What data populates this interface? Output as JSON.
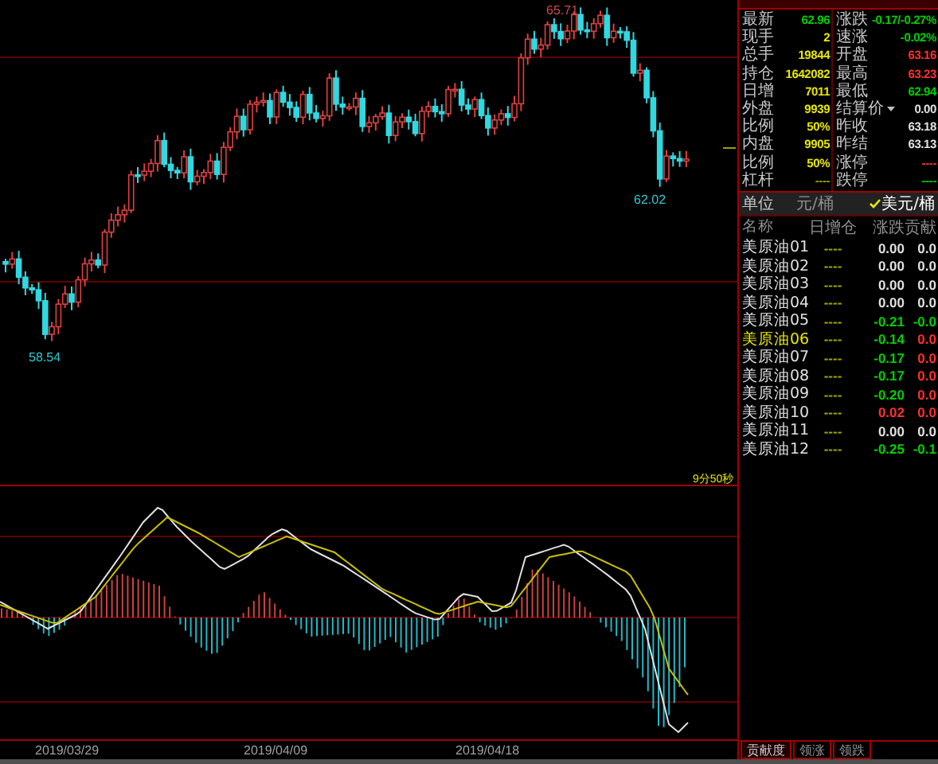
{
  "chart": {
    "high_label": "65.71",
    "low_label": "62.02",
    "start_low_label": "58.54",
    "timer": "9分50秒",
    "dates": [
      "2019/03/29",
      "2019/04/09",
      "2019/04/18"
    ]
  },
  "quote": {
    "left": [
      {
        "label": "最新",
        "value": "62.96",
        "color": "#00d000"
      },
      {
        "label": "现手",
        "value": "2",
        "color": "#e8e800"
      },
      {
        "label": "总手",
        "value": "19844",
        "color": "#e8e800"
      },
      {
        "label": "持仓",
        "value": "1642082",
        "color": "#e8e800"
      },
      {
        "label": "日增",
        "value": "7011",
        "color": "#e8e800"
      },
      {
        "label": "外盘",
        "value": "9939",
        "color": "#e8e800"
      },
      {
        "label": "比例",
        "value": "50%",
        "color": "#e8e800"
      },
      {
        "label": "内盘",
        "value": "9905",
        "color": "#e8e800"
      },
      {
        "label": "比例",
        "value": "50%",
        "color": "#e8e800"
      },
      {
        "label": "杠杆",
        "value": "----",
        "color": "#a0a000"
      }
    ],
    "right": [
      {
        "label": "涨跌",
        "value": "-0.17/-0.27%",
        "color": "#00d000",
        "has_menu": false
      },
      {
        "label": "速涨",
        "value": "-0.02%",
        "color": "#00d000",
        "has_menu": false
      },
      {
        "label": "开盘",
        "value": "63.16",
        "color": "#ff3030",
        "has_menu": false
      },
      {
        "label": "最高",
        "value": "63.23",
        "color": "#ff3030",
        "has_menu": false
      },
      {
        "label": "最低",
        "value": "62.94",
        "color": "#00d000",
        "has_menu": false
      },
      {
        "label": "结算价",
        "value": "0.00",
        "color": "#e0e0e0",
        "has_menu": true
      },
      {
        "label": "昨收",
        "value": "63.18",
        "color": "#e0e0e0",
        "has_menu": false
      },
      {
        "label": "昨结",
        "value": "63.13",
        "color": "#e0e0e0",
        "has_menu": false
      },
      {
        "label": "涨停",
        "value": "----",
        "color": "#ff3030",
        "has_menu": false
      },
      {
        "label": "跌停",
        "value": "----",
        "color": "#00d000",
        "has_menu": false
      }
    ]
  },
  "unit": {
    "label": "单位",
    "options": [
      {
        "label": "元/桶",
        "selected": false
      },
      {
        "label": "美元/桶",
        "selected": true
      }
    ]
  },
  "table": {
    "columns": [
      "名称",
      "日增仓",
      "涨跌",
      "贡献"
    ],
    "rows": [
      {
        "name": "美原油01",
        "selected": false,
        "position": "----",
        "change": {
          "text": "0.00",
          "color": "#e0e0e0"
        },
        "contrib": {
          "text": "0.0",
          "color": "#e0e0e0"
        }
      },
      {
        "name": "美原油02",
        "selected": false,
        "position": "----",
        "change": {
          "text": "0.00",
          "color": "#e0e0e0"
        },
        "contrib": {
          "text": "0.0",
          "color": "#e0e0e0"
        }
      },
      {
        "name": "美原油03",
        "selected": false,
        "position": "----",
        "change": {
          "text": "0.00",
          "color": "#e0e0e0"
        },
        "contrib": {
          "text": "0.0",
          "color": "#e0e0e0"
        }
      },
      {
        "name": "美原油04",
        "selected": false,
        "position": "----",
        "change": {
          "text": "0.00",
          "color": "#e0e0e0"
        },
        "contrib": {
          "text": "0.0",
          "color": "#e0e0e0"
        }
      },
      {
        "name": "美原油05",
        "selected": false,
        "position": "----",
        "change": {
          "text": "-0.21",
          "color": "#00d000"
        },
        "contrib": {
          "text": "-0.0",
          "color": "#00d000"
        }
      },
      {
        "name": "美原油06",
        "selected": true,
        "position": "----",
        "change": {
          "text": "-0.14",
          "color": "#00d000"
        },
        "contrib": {
          "text": "0.0",
          "color": "#ff3030"
        }
      },
      {
        "name": "美原油07",
        "selected": false,
        "position": "----",
        "change": {
          "text": "-0.17",
          "color": "#00d000"
        },
        "contrib": {
          "text": "0.0",
          "color": "#ff3030"
        }
      },
      {
        "name": "美原油08",
        "selected": false,
        "position": "----",
        "change": {
          "text": "-0.17",
          "color": "#00d000"
        },
        "contrib": {
          "text": "0.0",
          "color": "#ff3030"
        }
      },
      {
        "name": "美原油09",
        "selected": false,
        "position": "----",
        "change": {
          "text": "-0.20",
          "color": "#00d000"
        },
        "contrib": {
          "text": "0.0",
          "color": "#ff3030"
        }
      },
      {
        "name": "美原油10",
        "selected": false,
        "position": "----",
        "change": {
          "text": "0.02",
          "color": "#ff3030"
        },
        "contrib": {
          "text": "0.0",
          "color": "#ff3030"
        }
      },
      {
        "name": "美原油11",
        "selected": false,
        "position": "----",
        "change": {
          "text": "0.00",
          "color": "#e0e0e0"
        },
        "contrib": {
          "text": "0.0",
          "color": "#e0e0e0"
        }
      },
      {
        "name": "美原油12",
        "selected": false,
        "position": "----",
        "change": {
          "text": "-0.25",
          "color": "#00d000"
        },
        "contrib": {
          "text": "-0.1",
          "color": "#00d000"
        }
      }
    ]
  },
  "bottom_tabs": [
    {
      "label": "贡献度",
      "selected": true
    },
    {
      "label": "领涨",
      "selected": false
    },
    {
      "label": "领跌",
      "selected": false
    }
  ]
}
